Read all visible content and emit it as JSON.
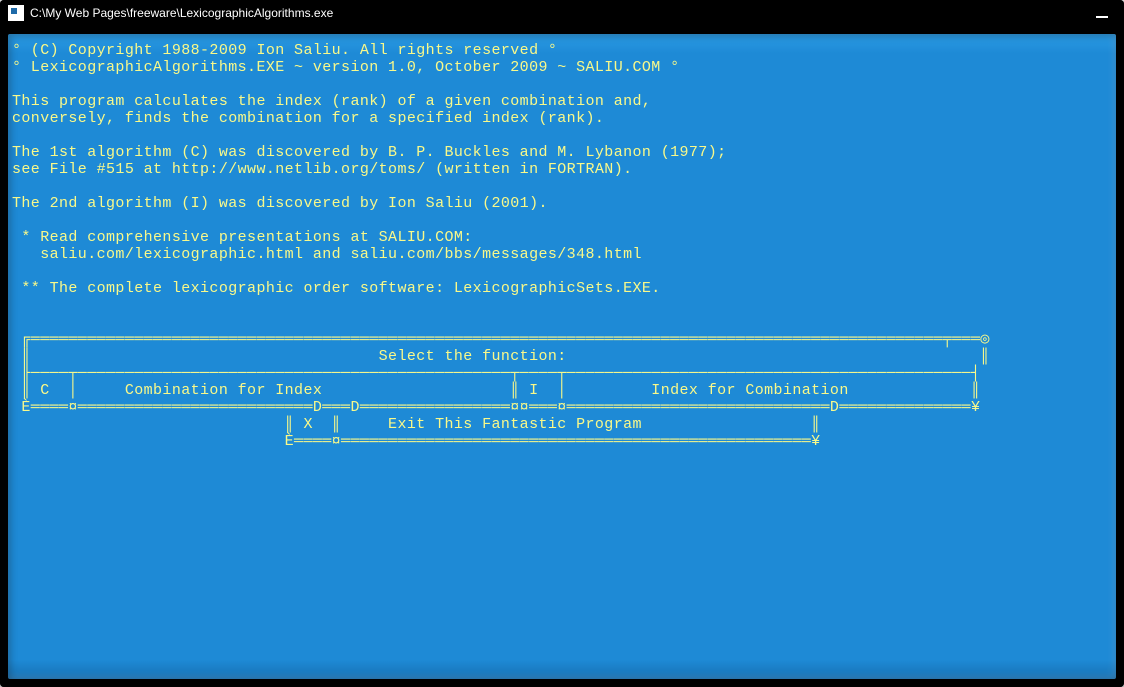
{
  "window": {
    "title": "C:\\My Web Pages\\freeware\\LexicographicAlgorithms.exe"
  },
  "intro": {
    "copyright": "° (C) Copyright 1988-2009 Ion Saliu. All rights reserved °",
    "version": "° LexicographicAlgorithms.EXE ~ version 1.0, October 2009 ~ SALIU.COM °",
    "desc1": "This program calculates the index (rank) of a given combination and,",
    "desc2": "conversely, finds the combination for a specified index (rank).",
    "algo1a": "The 1st algorithm (C) was discovered by B. P. Buckles and M. Lybanon (1977);",
    "algo1b": "see File #515 at http://www.netlib.org/toms/ (written in FORTRAN).",
    "algo2": "The 2nd algorithm (I) was discovered by Ion Saliu (2001).",
    "read1": " * Read comprehensive presentations at SALIU.COM:",
    "read2": "   saliu.com/lexicographic.html and saliu.com/bbs/messages/348.html",
    "complete": " ** The complete lexicographic order software: LexicographicSets.EXE."
  },
  "menu": {
    "header": "Select the function:",
    "optC_key": "C",
    "optC_label": "Combination for Index",
    "optI_key": "I",
    "optI_label": "Index for Combination",
    "optX_key": "X",
    "optX_label": "Exit This Fantastic Program"
  },
  "box": {
    "top": " ╔═════════════════════════════════════════════════════════════════════════════════════════════════╤═══◎",
    "hdr": " ║                                     Select the function:                                            ║",
    "sep1": " ╟────┬──────────────────────────────────────────────┬────┬───────────────────────────────────────────┤",
    "row1": " ║ C  │     Combination for Index                    ║ I  │         Index for Combination             ║",
    "sep2": " È════¤═════════════════════════D═══D════════════════¤¤═══¤════════════════════════════D══════════════¥",
    "row2": "                             ║ X  ║     Exit This Fantastic Program                  ║",
    "bot": "                             È════¤══════════════════════════════════════════════════¥"
  },
  "colors": {
    "bg": "#1e8ad6",
    "fg": "#f9f98a"
  }
}
